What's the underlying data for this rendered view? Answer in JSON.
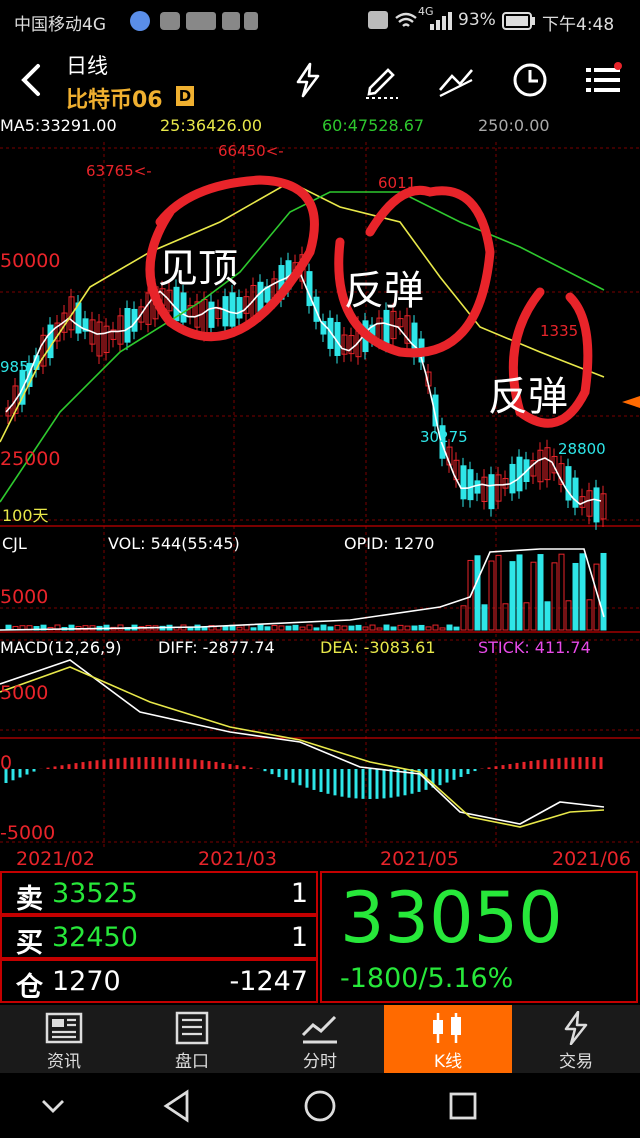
{
  "status_bar": {
    "carrier": "中国移动4G",
    "network": "4G",
    "battery": "93%",
    "time": "下午4:48"
  },
  "title_bar": {
    "period": "日线",
    "instrument": "比特币06",
    "instrument_badge": "D",
    "icons": [
      "back-arrow-icon",
      "lightning-icon",
      "draw-pen-icon",
      "trend-line-icon",
      "clock-icon",
      "list-menu-icon"
    ]
  },
  "ma_legend": {
    "ma5": "MA5:33291.00",
    "ma25": "25:36426.00",
    "ma60": "60:47528.67",
    "ma250": "250:0.00",
    "ma100": "100天"
  },
  "price_axis": {
    "top": "50000",
    "bottom": "25000",
    "left_tick": "985"
  },
  "price_annotations": {
    "high1": "63765<-",
    "high2": "66450<-",
    "high3": "6011",
    "high4": "1335",
    "low1": "30275",
    "low2": "28800"
  },
  "handwritten": {
    "circle1_text": "见顶",
    "circle2_text": "反弹",
    "circle3_text": "反弹"
  },
  "volume_panel": {
    "label": "CJL",
    "vol": "VOL: 544(55:45)",
    "opid": "OPID: 1270",
    "axis": "5000"
  },
  "macd_panel": {
    "label": "MACD(12,26,9)",
    "diff": "DIFF: -2877.74",
    "dea": "DEA: -3083.61",
    "stick": "STICK: 411.74",
    "axis_top": "5000",
    "axis_zero": "0",
    "axis_bottom": "-5000"
  },
  "date_axis": [
    "2021/02",
    "2021/03",
    "2021/05",
    "2021/06"
  ],
  "quote": {
    "sell_label": "卖",
    "sell_price": "33525",
    "sell_qty": "1",
    "buy_label": "买",
    "buy_price": "32450",
    "buy_qty": "1",
    "position_label": "仓",
    "position": "1270",
    "position_change": "-1247",
    "last_price": "33050",
    "change": "-1800/5.16%"
  },
  "tabs": [
    {
      "label": "资讯",
      "icon": "news-icon",
      "active": false
    },
    {
      "label": "盘口",
      "icon": "orderbook-icon",
      "active": false
    },
    {
      "label": "分时",
      "icon": "timeshare-icon",
      "active": false
    },
    {
      "label": "K线",
      "icon": "kline-icon",
      "active": true
    },
    {
      "label": "交易",
      "icon": "trade-icon",
      "active": false
    }
  ],
  "colors": {
    "up": "#e8242a",
    "down": "#2ee6e8",
    "ma5": "#ffffff",
    "ma25": "#e8e84a",
    "ma60": "#2ec82e",
    "grid": "#7a0000",
    "accent_orange": "#ff6a00",
    "price_green": "#27e83a",
    "annotation_red": "#e8242a"
  }
}
